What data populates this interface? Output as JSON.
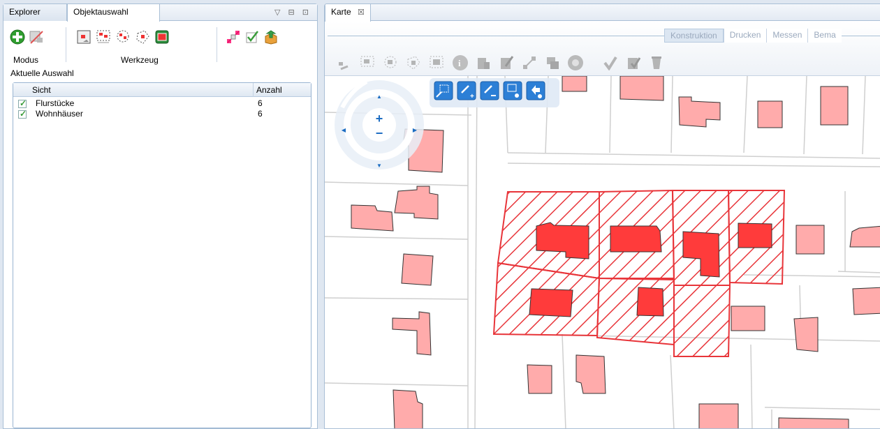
{
  "left_panel": {
    "tabs": [
      {
        "label": "Explorer"
      },
      {
        "label": "Objektauswahl"
      }
    ],
    "window_controls": "▽ ⊟ ⊡",
    "groups": {
      "modus": "Modus",
      "werkzeug": "Werkzeug"
    },
    "section_label": "Aktuelle Auswahl",
    "table": {
      "columns": [
        "Sicht",
        "Anzahl"
      ],
      "rows": [
        {
          "name": "Flurstücke",
          "count": "6",
          "checked": true
        },
        {
          "name": "Wohnhäuser",
          "count": "6",
          "checked": true
        }
      ]
    }
  },
  "right_panel": {
    "tab_label": "Karte",
    "tab_close": "☒",
    "ribbon_tabs": [
      "Konstruktion",
      "Drucken",
      "Messen",
      "Bema"
    ],
    "nav": {
      "zoom_in": "+",
      "zoom_out": "−",
      "up": "▲",
      "down": "▼",
      "left": "◀",
      "right": "▶"
    }
  },
  "colors": {
    "accent": "#2c7fd6",
    "selected_fill": "#ff2f2f",
    "parcel_stroke": "#e8353a",
    "building_fill": "#ffabab"
  }
}
